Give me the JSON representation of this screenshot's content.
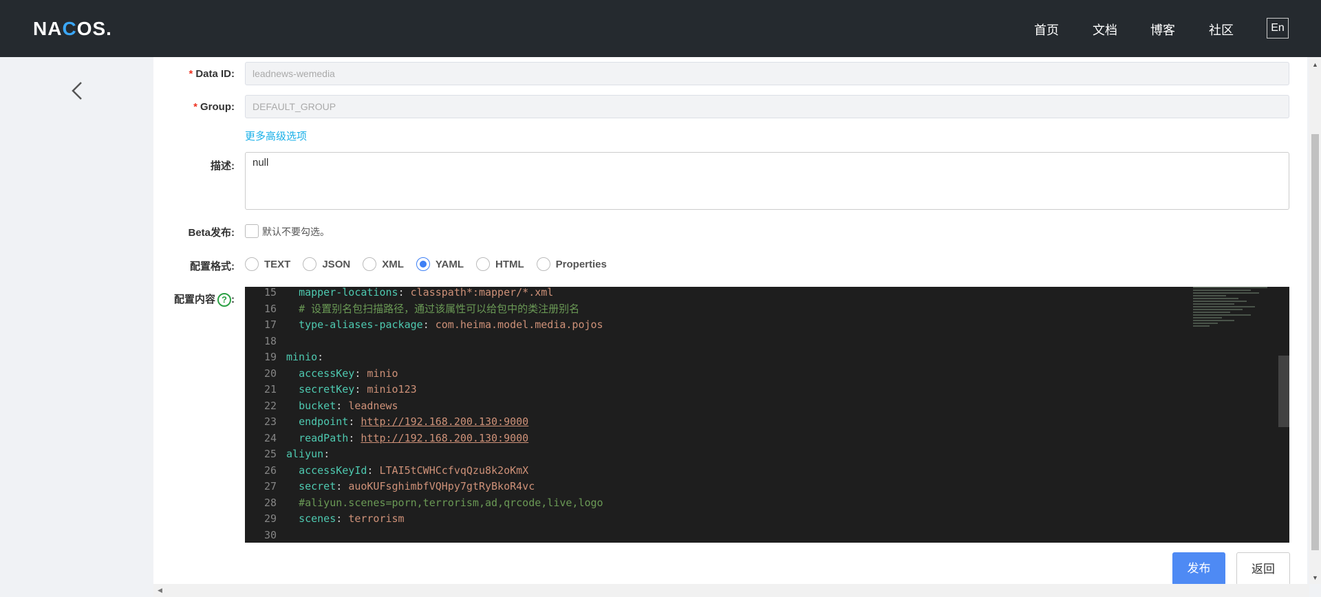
{
  "header": {
    "logo_text_1": "NA",
    "logo_text_2": "C",
    "logo_text_3": "OS.",
    "nav": [
      "首页",
      "文档",
      "博客",
      "社区"
    ],
    "lang_button": "En"
  },
  "form": {
    "data_id_label": "Data ID:",
    "data_id_value": "leadnews-wemedia",
    "group_label": "Group:",
    "group_value": "DEFAULT_GROUP",
    "more_options_link": "更多高级选项",
    "description_label": "描述:",
    "description_value": "null",
    "beta_label": "Beta发布:",
    "beta_hint": "默认不要勾选。",
    "format_label": "配置格式:",
    "formats": [
      "TEXT",
      "JSON",
      "XML",
      "YAML",
      "HTML",
      "Properties"
    ],
    "selected_format": "YAML",
    "content_label": "配置内容",
    "help_icon_glyph": "?"
  },
  "editor": {
    "lines": [
      {
        "n": "15",
        "parts": [
          [
            "p",
            "  "
          ],
          [
            "k",
            "mapper-locations"
          ],
          [
            "p",
            ": "
          ],
          [
            "v",
            "classpath*:mapper/*.xml"
          ]
        ]
      },
      {
        "n": "16",
        "parts": [
          [
            "p",
            "  "
          ],
          [
            "c",
            "# 设置别名包扫描路径，通过该属性可以给包中的类注册别名"
          ]
        ]
      },
      {
        "n": "17",
        "parts": [
          [
            "p",
            "  "
          ],
          [
            "k",
            "type-aliases-package"
          ],
          [
            "p",
            ": "
          ],
          [
            "v",
            "com.heima.model.media.pojos"
          ]
        ]
      },
      {
        "n": "18",
        "parts": []
      },
      {
        "n": "19",
        "parts": [
          [
            "k",
            "minio"
          ],
          [
            "p",
            ":"
          ]
        ]
      },
      {
        "n": "20",
        "parts": [
          [
            "p",
            "  "
          ],
          [
            "k",
            "accessKey"
          ],
          [
            "p",
            ": "
          ],
          [
            "v",
            "minio"
          ]
        ]
      },
      {
        "n": "21",
        "parts": [
          [
            "p",
            "  "
          ],
          [
            "k",
            "secretKey"
          ],
          [
            "p",
            ": "
          ],
          [
            "v",
            "minio123"
          ]
        ]
      },
      {
        "n": "22",
        "parts": [
          [
            "p",
            "  "
          ],
          [
            "k",
            "bucket"
          ],
          [
            "p",
            ": "
          ],
          [
            "v",
            "leadnews"
          ]
        ]
      },
      {
        "n": "23",
        "parts": [
          [
            "p",
            "  "
          ],
          [
            "k",
            "endpoint"
          ],
          [
            "p",
            ": "
          ],
          [
            "u",
            "http://192.168.200.130:9000"
          ]
        ]
      },
      {
        "n": "24",
        "parts": [
          [
            "p",
            "  "
          ],
          [
            "k",
            "readPath"
          ],
          [
            "p",
            ": "
          ],
          [
            "u",
            "http://192.168.200.130:9000"
          ]
        ]
      },
      {
        "n": "25",
        "parts": [
          [
            "k",
            "aliyun"
          ],
          [
            "p",
            ":"
          ]
        ]
      },
      {
        "n": "26",
        "parts": [
          [
            "p",
            "  "
          ],
          [
            "k",
            "accessKeyId"
          ],
          [
            "p",
            ": "
          ],
          [
            "v",
            "LTAI5tCWHCcfvqQzu8k2oKmX"
          ]
        ]
      },
      {
        "n": "27",
        "parts": [
          [
            "p",
            "  "
          ],
          [
            "k",
            "secret"
          ],
          [
            "p",
            ": "
          ],
          [
            "v",
            "auoKUFsghimbfVQHpy7gtRyBkoR4vc"
          ]
        ]
      },
      {
        "n": "28",
        "parts": [
          [
            "p",
            "  "
          ],
          [
            "c",
            "#aliyun.scenes=porn,terrorism,ad,qrcode,live,logo"
          ]
        ]
      },
      {
        "n": "29",
        "parts": [
          [
            "p",
            "  "
          ],
          [
            "k",
            "scenes"
          ],
          [
            "p",
            ": "
          ],
          [
            "v",
            "terrorism"
          ]
        ]
      },
      {
        "n": "30",
        "parts": []
      }
    ]
  },
  "actions": {
    "publish": "发布",
    "back": "返回"
  }
}
